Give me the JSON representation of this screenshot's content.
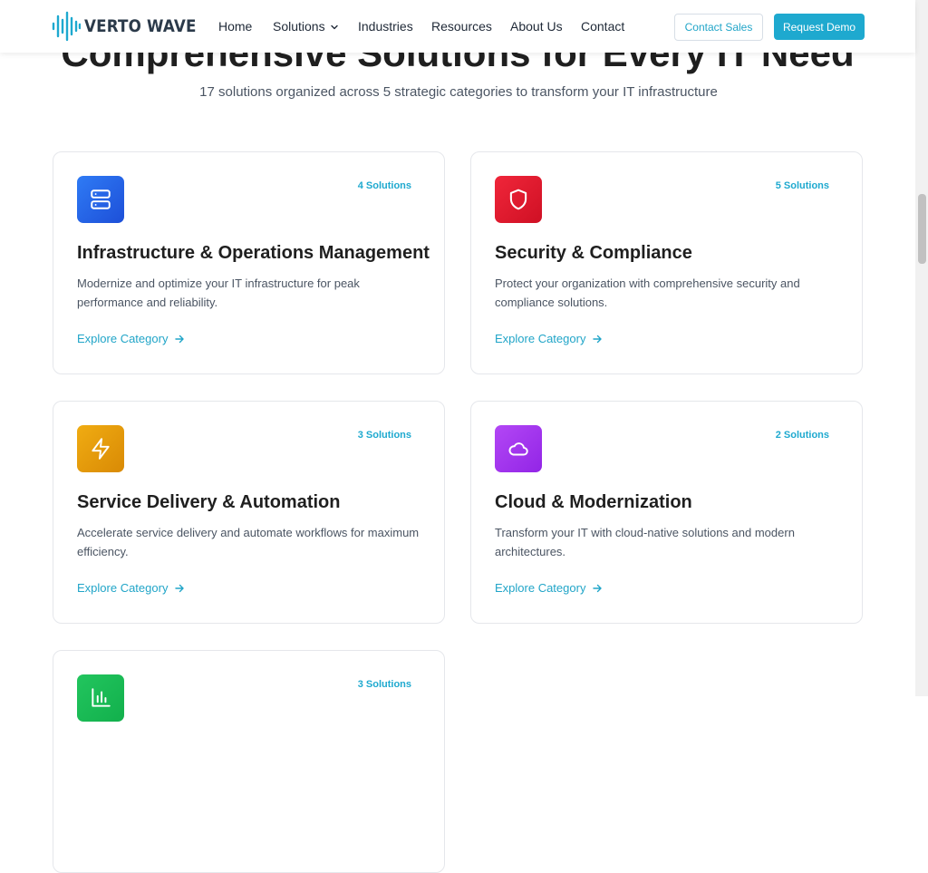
{
  "hero": {
    "title": "Comprehensive Solutions for Every IT Need",
    "subtitle": "17 solutions organized across 5 strategic categories to transform your IT infrastructure"
  },
  "header": {
    "logo_text": "VERTO WAVE",
    "nav": [
      "Home",
      "Solutions",
      "Industries",
      "Resources",
      "About Us",
      "Contact"
    ],
    "contact_sales": "Contact Sales",
    "request_demo": "Request Demo"
  },
  "cards": [
    {
      "count": "4 Solutions",
      "title": "Infrastructure & Operations Management",
      "desc": "Modernize and optimize your IT infrastructure for peak performance and reliability.",
      "link": "Explore Category",
      "icon": "server-icon",
      "color": "#2563eb"
    },
    {
      "count": "5 Solutions",
      "title": "Security & Compliance",
      "desc": "Protect your organization with comprehensive security and compliance solutions.",
      "link": "Explore Category",
      "icon": "shield-icon",
      "color": "#e11d2e"
    },
    {
      "count": "3 Solutions",
      "title": "Service Delivery & Automation",
      "desc": "Accelerate service delivery and automate workflows for maximum efficiency.",
      "link": "Explore Category",
      "icon": "lightning-icon",
      "color": "#e29a08"
    },
    {
      "count": "2 Solutions",
      "title": "Cloud & Modernization",
      "desc": "Transform your IT with cloud-native solutions and modern architectures.",
      "link": "Explore Category",
      "icon": "cloud-icon",
      "color": "#a433ee"
    },
    {
      "count": "3 Solutions",
      "icon": "chart-icon",
      "color": "#16c25a"
    }
  ],
  "colors": {
    "accent": "#1ea9cf",
    "heading": "#1f1f1f",
    "body_text": "#4b5563"
  }
}
